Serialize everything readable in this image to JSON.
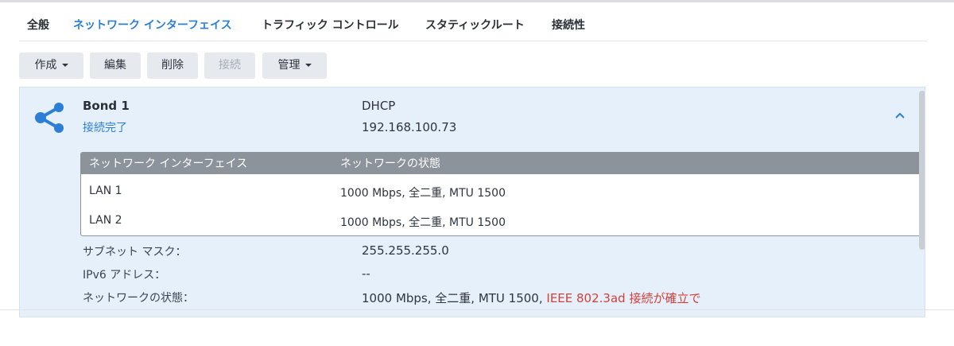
{
  "tabs": [
    {
      "label": "全般"
    },
    {
      "label": "ネットワーク インターフェイス",
      "active": true
    },
    {
      "label": "トラフィック コントロール"
    },
    {
      "label": "スタティックルート"
    },
    {
      "label": "接続性"
    }
  ],
  "toolbar": {
    "create": "作成",
    "edit": "編集",
    "delete": "削除",
    "connect": "接続",
    "manage": "管理"
  },
  "bond": {
    "name": "Bond 1",
    "status": "接続完了",
    "mode": "DHCP",
    "ip": "192.168.100.73",
    "icon": "share-icon",
    "accent": "#2c7fd6"
  },
  "interfaces": {
    "headers": [
      "ネットワーク インターフェイス",
      "ネットワークの状態"
    ],
    "rows": [
      {
        "name": "LAN 1",
        "state": "1000 Mbps, 全二重, MTU 1500"
      },
      {
        "name": "LAN 2",
        "state": "1000 Mbps, 全二重, MTU 1500"
      }
    ]
  },
  "details": {
    "subnet_label": "サブネット マスク：",
    "subnet_value": "255.255.255.0",
    "ipv6_label": "IPv6 アドレス：",
    "ipv6_value": "--",
    "state_label": "ネットワークの状態：",
    "state_value": "1000 Mbps, 全二重, MTU 1500, ",
    "state_warning": "IEEE 802.3ad 接続が確立で",
    "warning_color": "#d43f3a"
  }
}
